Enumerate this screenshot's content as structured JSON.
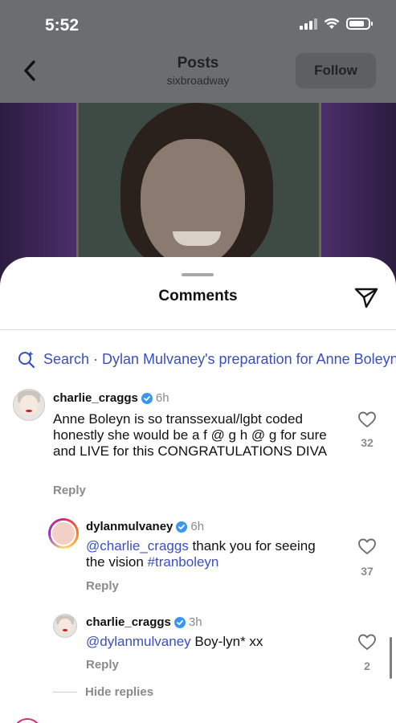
{
  "status_bar": {
    "time": "5:52"
  },
  "header": {
    "title": "Posts",
    "subtitle": "sixbroadway",
    "follow_label": "Follow"
  },
  "sheet": {
    "title": "Comments"
  },
  "search": {
    "text": "Search · Dylan Mulvaney's preparation for Anne Boleyn"
  },
  "comments": [
    {
      "username": "charlie_craggs",
      "time": "6h",
      "text": "Anne Boleyn is so transsexual/lgbt coded honestly she would be a f @ g h @ g for sure and LIVE for this CONGRATULATIONS DIVA",
      "reply_label": "Reply",
      "likes": "32"
    },
    {
      "username": "dylanmulvaney",
      "time": "6h",
      "mention": "@charlie_craggs",
      "text": " thank you for seeing the vision ",
      "hashtag": "#tranboleyn",
      "reply_label": "Reply",
      "likes": "37"
    },
    {
      "username": "charlie_craggs",
      "time": "3h",
      "mention": "@dylanmulvaney",
      "text": " Boy-lyn* xx",
      "reply_label": "Reply",
      "likes": "2"
    }
  ],
  "hide_replies_label": "Hide replies",
  "colors": {
    "link": "#3a4fc1",
    "verified": "#3897f0",
    "muted": "#8a8a8a"
  }
}
